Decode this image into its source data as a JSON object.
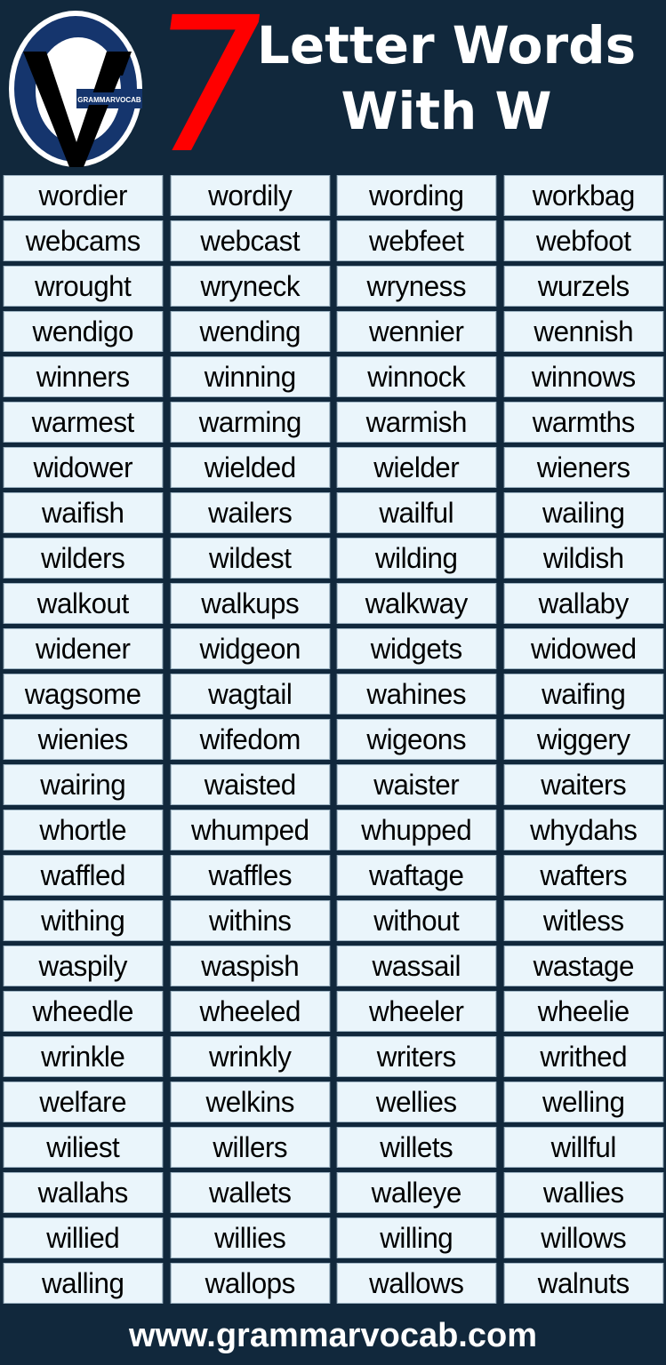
{
  "header": {
    "logo_text": "GRAMMARVOCAB",
    "number": "7",
    "title_line1": "Letter Words",
    "title_line2": "With W"
  },
  "colors": {
    "background": "#11283c",
    "number": "#ff0000",
    "cell_bg": "#eaf5fb",
    "logo_blue": "#15356d"
  },
  "words": [
    [
      "wordier",
      "wordily",
      "wording",
      "workbag"
    ],
    [
      "webcams",
      "webcast",
      "webfeet",
      "webfoot"
    ],
    [
      "wrought",
      "wryneck",
      "wryness",
      "wurzels"
    ],
    [
      "wendigo",
      "wending",
      "wennier",
      "wennish"
    ],
    [
      "winners",
      "winning",
      "winnock",
      "winnows"
    ],
    [
      "warmest",
      "warming",
      "warmish",
      "warmths"
    ],
    [
      "widower",
      "wielded",
      "wielder",
      "wieners"
    ],
    [
      "waifish",
      "wailers",
      "wailful",
      "wailing"
    ],
    [
      "wilders",
      "wildest",
      "wilding",
      "wildish"
    ],
    [
      "walkout",
      "walkups",
      "walkway",
      "wallaby"
    ],
    [
      "widener",
      "widgeon",
      "widgets",
      "widowed"
    ],
    [
      "wagsome",
      "wagtail",
      "wahines",
      "waifing"
    ],
    [
      "wienies",
      "wifedom",
      "wigeons",
      "wiggery"
    ],
    [
      "wairing",
      "waisted",
      "waister",
      "waiters"
    ],
    [
      "whortle",
      "whumped",
      "whupped",
      "whydahs"
    ],
    [
      "waffled",
      "waffles",
      "waftage",
      "wafters"
    ],
    [
      "withing",
      "withins",
      "without",
      "witless"
    ],
    [
      "waspily",
      "waspish",
      "wassail",
      "wastage"
    ],
    [
      "wheedle",
      "wheeled",
      "wheeler",
      "wheelie"
    ],
    [
      "wrinkle",
      "wrinkly",
      "writers",
      "writhed"
    ],
    [
      "welfare",
      "welkins",
      "wellies",
      "welling"
    ],
    [
      "wiliest",
      "willers",
      "willets",
      "willful"
    ],
    [
      "wallahs",
      "wallets",
      "walleye",
      "wallies"
    ],
    [
      "willied",
      "willies",
      "willing",
      "willows"
    ],
    [
      "walling",
      "wallops",
      "wallows",
      "walnuts"
    ]
  ],
  "footer": {
    "url": "www.grammarvocab.com"
  }
}
